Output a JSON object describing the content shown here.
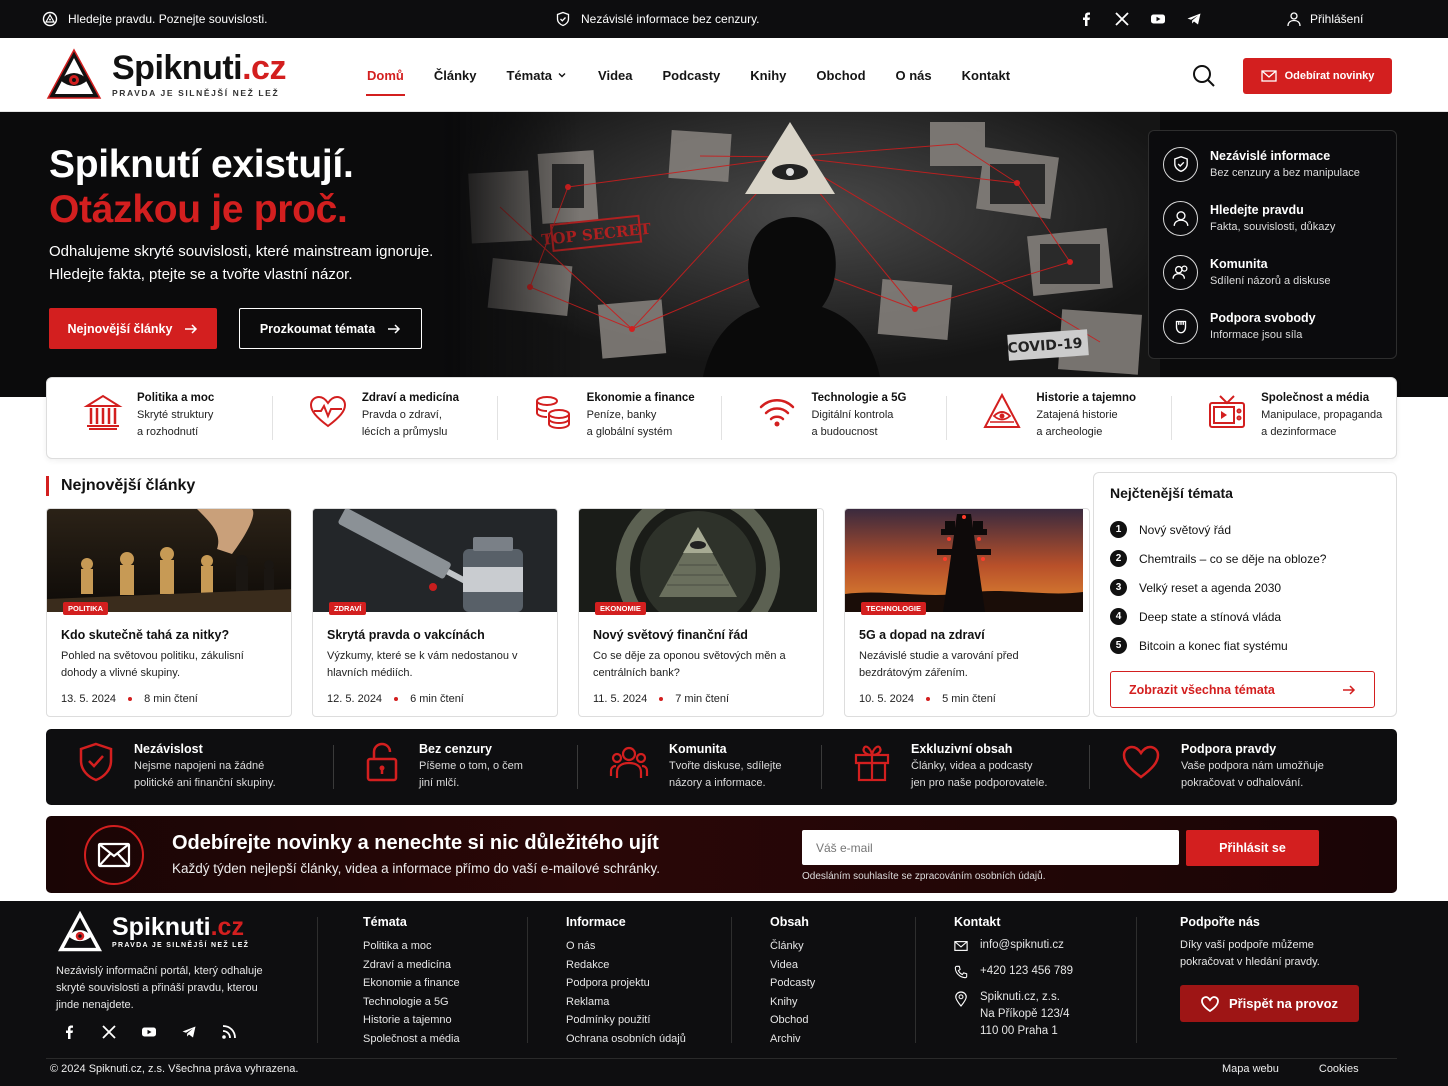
{
  "topbar": {
    "slogan": "Hledejte pravdu. Poznejte souvislosti.",
    "middle": "Nezávislé informace bez cenzury.",
    "login": "Přihlášení"
  },
  "header": {
    "logo_main": "Spiknuti",
    "logo_tld": ".cz",
    "logo_tagline": "PRAVDA JE SILNĚJŠÍ NEŽ LEŽ",
    "nav": [
      "Domů",
      "Články",
      "Témata",
      "Videa",
      "Podcasty",
      "Knihy",
      "Obchod",
      "O nás",
      "Kontakt"
    ],
    "subscribe_button": "Odebírat novinky"
  },
  "hero": {
    "title_line1": "Spiknutí existují.",
    "title_line2": "Otázkou je proč.",
    "text": "Odhalujeme skryté souvislosti, které mainstream ignoruje. Hledejte fakta, ptejte se a tvořte vlastní názor.",
    "btn_primary": "Nejnovější články",
    "btn_secondary": "Prozkoumat témata",
    "panel": [
      {
        "title": "Nezávislé informace",
        "sub": "Bez cenzury a bez manipulace"
      },
      {
        "title": "Hledejte pravdu",
        "sub": "Fakta, souvislosti, důkazy"
      },
      {
        "title": "Komunita",
        "sub": "Sdílení názorů a diskuse"
      },
      {
        "title": "Podpora svobody",
        "sub": "Informace jsou síla"
      }
    ],
    "image_labels": [
      "TOP SECRET",
      "COVID-19"
    ]
  },
  "topics": [
    {
      "title": "Politika a moc",
      "l1": "Skryté struktury",
      "l2": "a rozhodnutí"
    },
    {
      "title": "Zdraví a medicína",
      "l1": "Pravda o zdraví,",
      "l2": "lécích a průmyslu"
    },
    {
      "title": "Ekonomie a finance",
      "l1": "Peníze, banky",
      "l2": "a globální systém"
    },
    {
      "title": "Technologie a 5G",
      "l1": "Digitální kontrola",
      "l2": "a budoucnost"
    },
    {
      "title": "Historie a tajemno",
      "l1": "Zatajená historie",
      "l2": "a archeologie"
    },
    {
      "title": "Společnost a média",
      "l1": "Manipulace, propaganda",
      "l2": "a dezinformace"
    }
  ],
  "latest": {
    "title": "Nejnovější články",
    "articles": [
      {
        "badge": "POLITIKA",
        "title": "Kdo skutečně tahá za nitky?",
        "text": "Pohled na světovou politiku, zákulisní dohody a vlivné skupiny.",
        "date": "13. 5. 2024",
        "read": "8 min čtení"
      },
      {
        "badge": "ZDRAVÍ",
        "title": "Skrytá pravda o vakcínách",
        "text": "Výzkumy, které se k vám nedostanou v hlavních médiích.",
        "date": "12. 5. 2024",
        "read": "6 min čtení"
      },
      {
        "badge": "EKONOMIE",
        "title": "Nový světový finanční řád",
        "text": "Co se děje za oponou světových měn a centrálních bank?",
        "date": "11. 5. 2024",
        "read": "7 min čtení"
      },
      {
        "badge": "TECHNOLOGIE",
        "title": "5G a dopad na zdraví",
        "text": "Nezávislé studie a varování před bezdrátovým zářením.",
        "date": "10. 5. 2024",
        "read": "5 min čtení"
      }
    ]
  },
  "trending": {
    "title": "Nejčtenější témata",
    "items": [
      "Nový světový řád",
      "Chemtrails – co se děje na obloze?",
      "Velký reset a agenda 2030",
      "Deep state a stínová vláda",
      "Bitcoin a konec fiat systému"
    ],
    "button": "Zobrazit všechna témata"
  },
  "values": [
    {
      "title": "Nezávislost",
      "l1": "Nejsme napojeni na žádné",
      "l2": "politické ani finanční skupiny."
    },
    {
      "title": "Bez cenzury",
      "l1": "Píšeme o tom, o čem",
      "l2": "jiní mlčí."
    },
    {
      "title": "Komunita",
      "l1": "Tvořte diskuse, sdílejte",
      "l2": "názory a informace."
    },
    {
      "title": "Exkluzivní obsah",
      "l1": "Články, videa a podcasty",
      "l2": "jen pro naše podporovatele."
    },
    {
      "title": "Podpora pravdy",
      "l1": "Vaše podpora nám umožňuje",
      "l2": "pokračovat v odhalování."
    }
  ],
  "newsletter": {
    "title": "Odebírejte novinky a nenechte si nic důležitého ujít",
    "sub": "Každý týden nejlepší články, videa a informace přímo do vaší e-mailové schránky.",
    "placeholder": "Váš e-mail",
    "button": "Přihlásit se",
    "note": "Odesláním souhlasíte se zpracováním osobních údajů."
  },
  "footer": {
    "desc": "Nezávislý informační portál, který odhaluje skryté souvislosti a přináší pravdu, kterou jinde nenajdete.",
    "cols": [
      {
        "title": "Témata",
        "items": [
          "Politika a moc",
          "Zdraví a medicína",
          "Ekonomie a finance",
          "Technologie a 5G",
          "Historie a tajemno",
          "Společnost a média"
        ]
      },
      {
        "title": "Informace",
        "items": [
          "O nás",
          "Redakce",
          "Podpora projektu",
          "Reklama",
          "Podmínky použití",
          "Ochrana osobních údajů"
        ]
      },
      {
        "title": "Obsah",
        "items": [
          "Články",
          "Videa",
          "Podcasty",
          "Knihy",
          "Obchod",
          "Archiv"
        ]
      }
    ],
    "contact": {
      "title": "Kontakt",
      "email": "info@spiknuti.cz",
      "phone": "+420 123 456 789",
      "addr1": "Spiknuti.cz, z.s.",
      "addr2": "Na Příkopě 123/4",
      "addr3": "110 00 Praha 1"
    },
    "support": {
      "title": "Podpořte nás",
      "text": "Díky vaší podpoře můžeme pokračovat v hledání pravdy.",
      "button": "Přispět na provoz"
    },
    "copyright": "© 2024 Spiknuti.cz, z.s. Všechna práva vyhrazena.",
    "links": [
      "Mapa webu",
      "Cookies"
    ]
  },
  "colors": {
    "accent": "#d31f1f",
    "dark": "#0e0e10"
  }
}
